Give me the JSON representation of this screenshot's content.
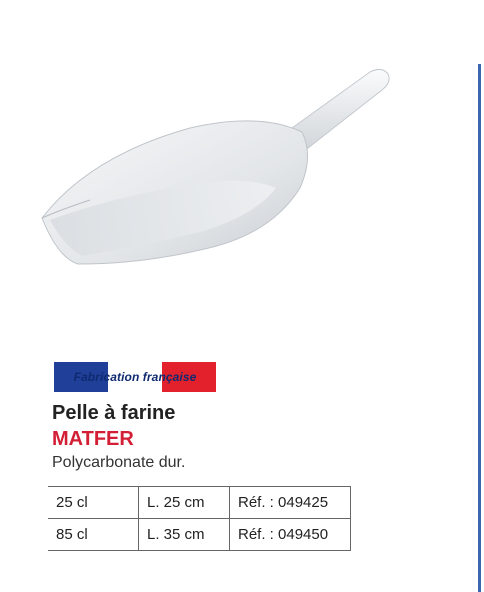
{
  "banner": {
    "label": "Fabrication française"
  },
  "product": {
    "title": "Pelle à farine",
    "brand": "MATFER",
    "material": "Polycarbonate dur."
  },
  "specs": [
    {
      "capacity": "25 cl",
      "length": "L. 25 cm",
      "ref": "Réf. : 049425"
    },
    {
      "capacity": "85 cl",
      "length": "L. 35 cm",
      "ref": "Réf. : 049450"
    }
  ],
  "colors": {
    "flag_blue": "#1f3f98",
    "flag_red": "#e2212c",
    "brand_red": "#d21f36",
    "rule_blue": "#3a66b1"
  }
}
